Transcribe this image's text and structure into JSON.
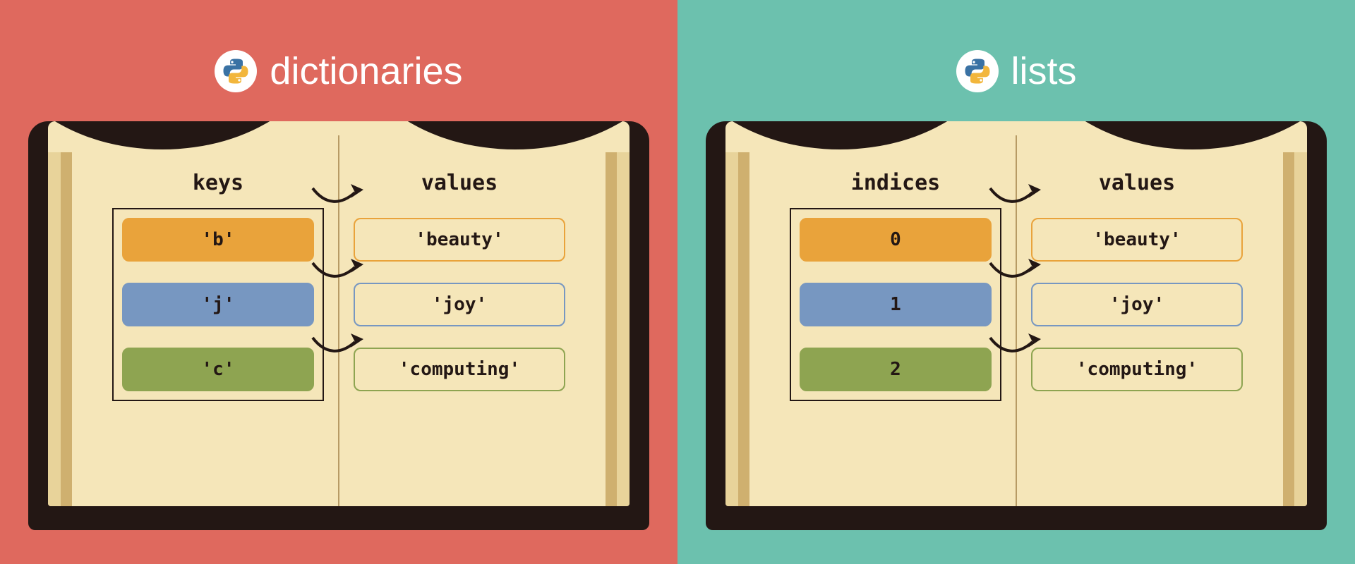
{
  "left": {
    "title": "dictionaries",
    "left_header": "keys",
    "right_header": "values",
    "rows": [
      {
        "key": "'b'",
        "value": "'beauty'"
      },
      {
        "key": "'j'",
        "value": "'joy'"
      },
      {
        "key": "'c'",
        "value": "'computing'"
      }
    ]
  },
  "right": {
    "title": "lists",
    "left_header": "indices",
    "right_header": "values",
    "rows": [
      {
        "key": "0",
        "value": "'beauty'"
      },
      {
        "key": "1",
        "value": "'joy'"
      },
      {
        "key": "2",
        "value": "'computing'"
      }
    ]
  },
  "colors": {
    "panel_left": "#df695e",
    "panel_right": "#6cc1ae",
    "book_cover": "#231714",
    "page": "#f5e6b9",
    "orange": "#e9a33b",
    "blue": "#7797c1",
    "green": "#8ea451"
  }
}
